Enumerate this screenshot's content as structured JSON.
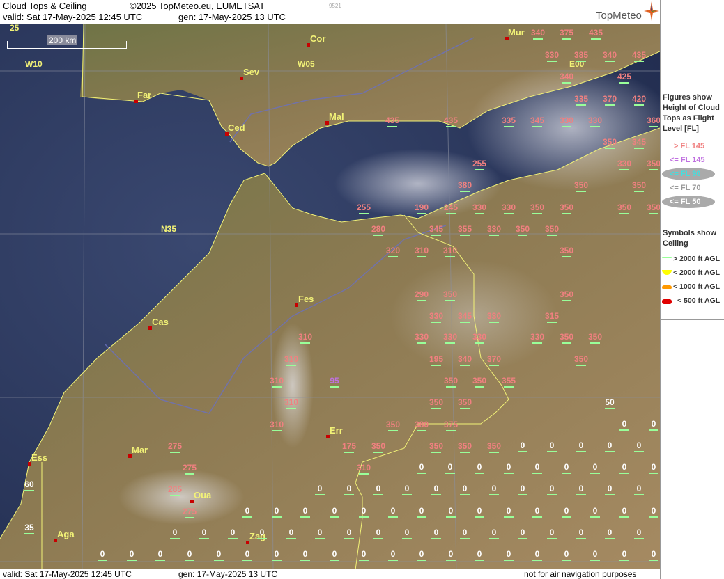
{
  "header": {
    "title": "Cloud Tops & Ceiling",
    "copyright": "©2025 TopMeteo.eu, EUMETSAT",
    "code": "9521",
    "valid": "valid:  Sat  17-May-2025  12:45 UTC",
    "gen": "gen: 17-May-2025 13 UTC",
    "logo": "TopMeteo"
  },
  "footer": {
    "valid": "valid:  Sat  17-May-2025  12:45 UTC",
    "gen": "gen: 17-May-2025 13 UTC",
    "disclaimer": "not for air navigation purposes"
  },
  "legend": {
    "figures_title": [
      "Figures show",
      "Height of Cloud",
      "Tops as Flight",
      "Level  [FL]"
    ],
    "fl_items": [
      {
        "label": "> FL 145",
        "color": "#f08080",
        "oval": false
      },
      {
        "label": "<= FL 145",
        "color": "#c070e0",
        "oval": false
      },
      {
        "label": "<= FL 90",
        "color": "#40e0e0",
        "oval": true
      },
      {
        "label": "<= FL 70",
        "color": "#999999",
        "oval": false
      },
      {
        "label": "<= FL 50",
        "color": "#ffffff",
        "oval": true
      }
    ],
    "symbols_title": [
      "Symbols show",
      "Ceiling"
    ],
    "symbol_items": [
      {
        "label": "> 2000 ft AGL",
        "color": "#99ff99"
      },
      {
        "label": "< 2000 ft AGL",
        "color": "#ffff00"
      },
      {
        "label": "< 1000 ft AGL",
        "color": "#ff9900"
      },
      {
        "label": "< 500 ft AGL",
        "color": "#e00000"
      }
    ]
  },
  "map": {
    "scale_label": "200 km",
    "grid_labels": [
      {
        "text": "25",
        "pos": "top-left"
      },
      {
        "text": "W10"
      },
      {
        "text": "W05"
      },
      {
        "text": "E00"
      },
      {
        "text": "N35"
      }
    ],
    "cities": [
      "Cor",
      "Mur",
      "Sev",
      "Far",
      "Ced",
      "Mal",
      "Fes",
      "Cas",
      "Err",
      "Mar",
      "Ess",
      "Oua",
      "Aga",
      "Zag"
    ],
    "edge_values": [
      "60",
      "35"
    ],
    "cloud_top_values": [
      "340",
      "375",
      "435",
      "330",
      "385",
      "340",
      "435",
      "340",
      "425",
      "335",
      "370",
      "420",
      "435",
      "435",
      "335",
      "345",
      "330",
      "330",
      "360",
      "350",
      "345",
      "330",
      "350",
      "255",
      "380",
      "350",
      "350",
      "255",
      "190",
      "245",
      "330",
      "330",
      "350",
      "350",
      "350",
      "350",
      "280",
      "345",
      "355",
      "330",
      "350",
      "350",
      "320",
      "310",
      "310",
      "350",
      "290",
      "350",
      "350",
      "330",
      "345",
      "330",
      "315",
      "310",
      "330",
      "330",
      "330",
      "330",
      "350",
      "350",
      "195",
      "340",
      "370",
      "350",
      "310",
      "350",
      "350",
      "355",
      "310",
      "95",
      "350",
      "350",
      "310",
      "350",
      "380",
      "375",
      "310",
      "175",
      "350",
      "350",
      "350",
      "350",
      "275",
      "275",
      "310",
      "285",
      "275",
      "50"
    ]
  }
}
